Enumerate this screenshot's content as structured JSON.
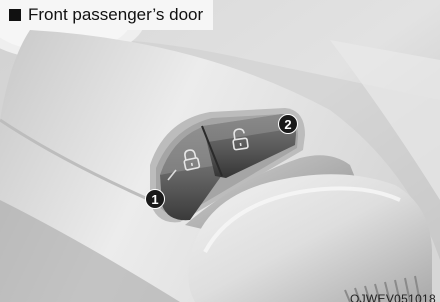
{
  "caption": {
    "marker": "square-bullet",
    "text": "Front passenger’s door"
  },
  "callouts": [
    {
      "label": "1",
      "target": "lock-button"
    },
    {
      "label": "2",
      "target": "unlock-button"
    }
  ],
  "figure_code": "OJWEV051018",
  "icons": {
    "lock_button": "padlock-closed-icon",
    "unlock_button": "padlock-open-icon"
  }
}
